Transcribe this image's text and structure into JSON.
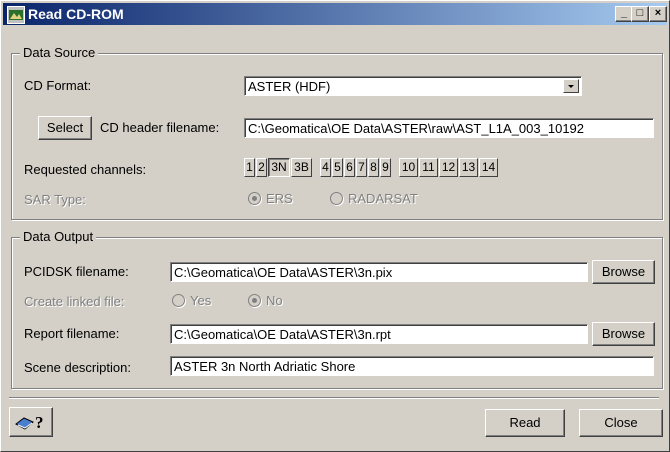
{
  "window": {
    "title": "Read CD-ROM",
    "minimize": "_",
    "maximize": "□",
    "close": "×"
  },
  "data_source": {
    "legend": "Data Source",
    "cd_format_label": "CD Format:",
    "cd_format_value": "ASTER (HDF)",
    "select_label": "Select",
    "cd_header_label": "CD header filename:",
    "cd_header_value": "C:\\Geomatica\\OE Data\\ASTER\\raw\\AST_L1A_003_10192",
    "requested_label": "Requested channels:",
    "channels": [
      "1",
      "2",
      "3N",
      "3B",
      "4",
      "5",
      "6",
      "7",
      "8",
      "9",
      "10",
      "11",
      "12",
      "13",
      "14"
    ],
    "selected_channel": "3N",
    "sar_label": "SAR Type:",
    "sar_options": [
      "ERS",
      "RADARSAT"
    ],
    "sar_selected": "ERS"
  },
  "data_output": {
    "legend": "Data Output",
    "pcidsk_label": "PCIDSK filename:",
    "pcidsk_value": "C:\\Geomatica\\OE Data\\ASTER\\3n.pix",
    "browse_label": "Browse",
    "linked_label": "Create linked file:",
    "linked_yes": "Yes",
    "linked_no": "No",
    "linked_selected": "No",
    "report_label": "Report filename:",
    "report_value": "C:\\Geomatica\\OE Data\\ASTER\\3n.rpt",
    "report_browse": "Browse",
    "scene_label": "Scene description:",
    "scene_value": "ASTER 3n North Adriatic Shore"
  },
  "footer": {
    "help_icon": "book-help-icon",
    "help_mark": "?",
    "read_label": "Read",
    "close_label": "Close"
  }
}
